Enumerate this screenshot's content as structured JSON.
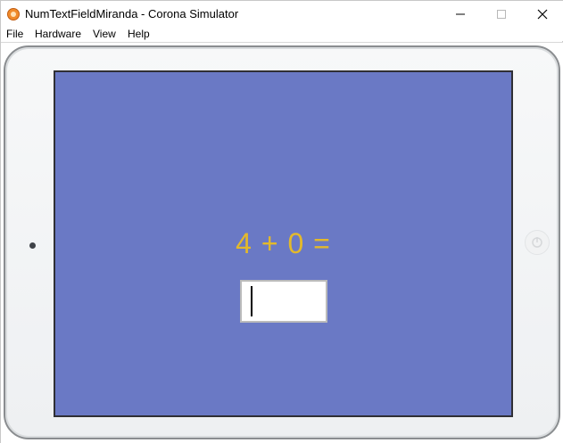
{
  "window": {
    "title": "NumTextFieldMiranda - Corona Simulator"
  },
  "menu": {
    "items": [
      {
        "label": "File"
      },
      {
        "label": "Hardware"
      },
      {
        "label": "View"
      },
      {
        "label": "Help"
      }
    ]
  },
  "screen": {
    "background": "#6a79c5",
    "equation": "4 + 0 =",
    "equation_color": "#e3b92b",
    "answer": {
      "value": ""
    }
  },
  "icons": {
    "app": "corona-logo-icon",
    "minimize": "minimize-icon",
    "maximize": "maximize-icon",
    "close": "close-icon",
    "home": "home-button-icon",
    "camera": "camera-icon"
  }
}
